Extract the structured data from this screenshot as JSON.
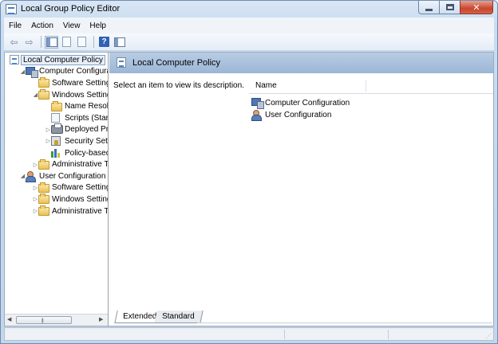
{
  "window": {
    "title": "Local Group Policy Editor",
    "close_glyph": "✕"
  },
  "menubar": {
    "items": [
      "File",
      "Action",
      "View",
      "Help"
    ]
  },
  "toolbar": {
    "back_glyph": "⇦",
    "forward_glyph": "⇨",
    "help_glyph": "?"
  },
  "tree": {
    "rows": [
      {
        "label": "Local Computer Policy",
        "icon": "policy-icon",
        "level": 0,
        "expander": "",
        "selected": true
      },
      {
        "label": "Computer Configura",
        "icon": "computer-icon",
        "level": 1,
        "expander": "◢"
      },
      {
        "label": "Software Settings",
        "icon": "folder-icon",
        "level": 2,
        "expander": ""
      },
      {
        "label": "Windows Setting",
        "icon": "folder-icon",
        "level": 2,
        "expander": "◢"
      },
      {
        "label": "Name Resolu",
        "icon": "folder-icon",
        "level": 3,
        "expander": ""
      },
      {
        "label": "Scripts (Startu",
        "icon": "script-icon",
        "level": 3,
        "expander": ""
      },
      {
        "label": "Deployed Prin",
        "icon": "printer-icon",
        "level": 3,
        "expander": "▷"
      },
      {
        "label": "Security Settin",
        "icon": "security-icon",
        "level": 3,
        "expander": "▷"
      },
      {
        "label": "Policy-based",
        "icon": "chart-icon",
        "level": 3,
        "expander": ""
      },
      {
        "label": "Administrative Te",
        "icon": "folder-icon",
        "level": 2,
        "expander": "▷"
      },
      {
        "label": "User Configuration",
        "icon": "users-icon",
        "level": 1,
        "expander": "◢"
      },
      {
        "label": "Software Settings",
        "icon": "folder-icon",
        "level": 2,
        "expander": "▷"
      },
      {
        "label": "Windows Setting",
        "icon": "folder-icon",
        "level": 2,
        "expander": "▷"
      },
      {
        "label": "Administrative Te",
        "icon": "folder-icon",
        "level": 2,
        "expander": "▷"
      }
    ],
    "scroll_left": "◀",
    "scroll_right": "▶",
    "thumb_grip": "|||"
  },
  "details": {
    "header_title": "Local Computer Policy",
    "description": "Select an item to view its description.",
    "column_name": "Name",
    "items": [
      {
        "label": "Computer Configuration",
        "icon": "computer-icon"
      },
      {
        "label": "User Configuration",
        "icon": "users-icon"
      }
    ]
  },
  "tabs": {
    "extended": "Extended",
    "standard": "Standard"
  },
  "statusbar": {
    "grip": "⋰"
  }
}
